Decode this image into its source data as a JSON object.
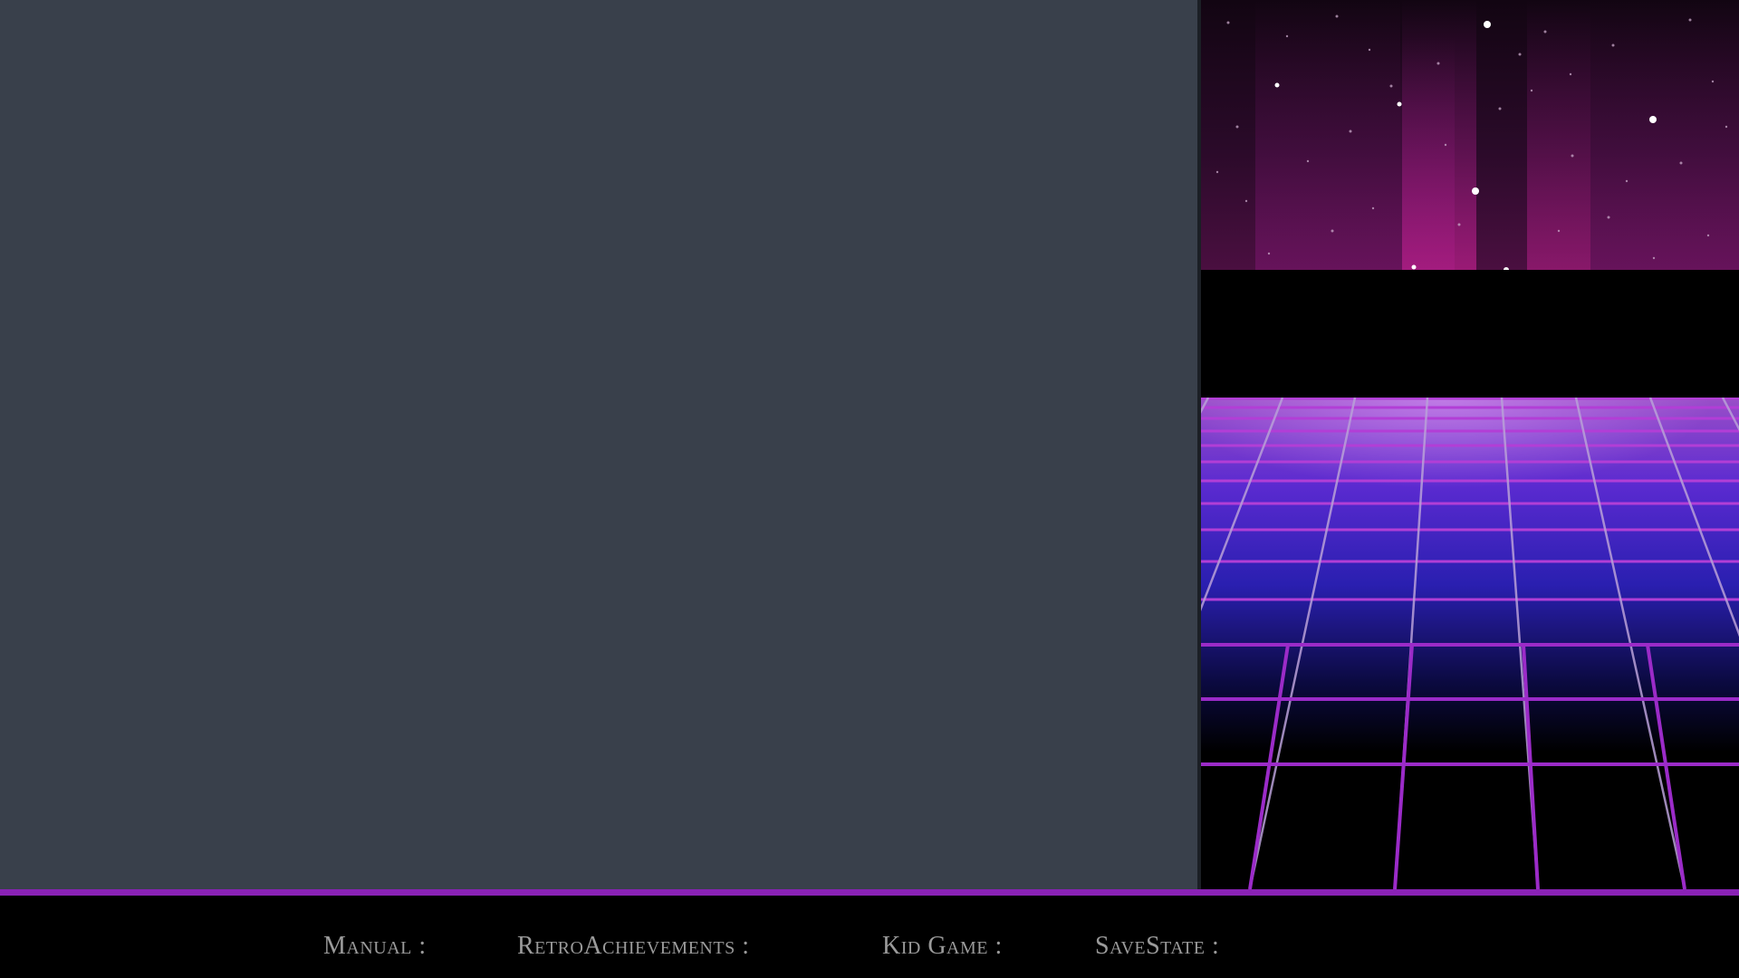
{
  "footer": {
    "hints": {
      "manual": "Manual :",
      "retroachievements": "RetroAchievements :",
      "kid_game": "Kid Game :",
      "savestate": "SaveState :"
    }
  },
  "theme": {
    "left_panel_color": "#39404b",
    "accent_color": "#8a22b6",
    "grid_line_color": "#b23ed6",
    "sky_glow_color": "#9b1a8c",
    "hint_text_color": "#9a9a9a"
  },
  "artwork": {
    "sky": "starfield-icon",
    "floor": "synthwave-grid-icon"
  }
}
